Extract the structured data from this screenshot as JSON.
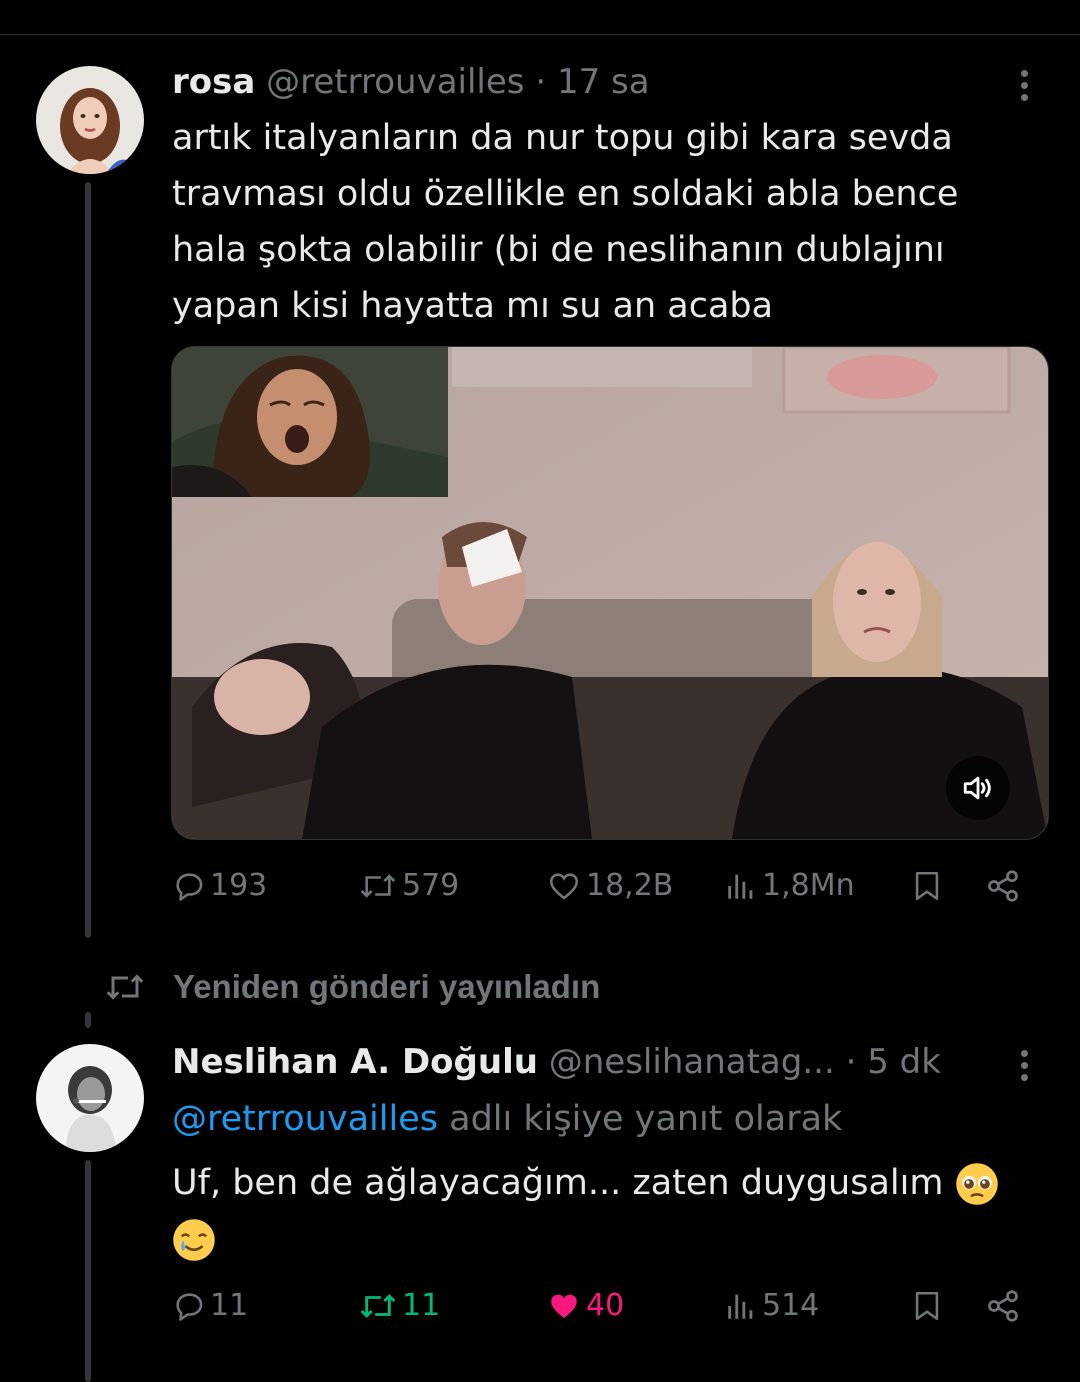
{
  "tweet1": {
    "display_name": "rosa",
    "handle": "@retrrouvailles",
    "separator": "·",
    "time": "17 sa",
    "text": "artık italyanların da nur topu gibi kara sevda travması oldu özellikle en soldaki abla bence hala şokta olabilir (bi de neslihanın dublajını yapan kisi hayatta mı su an acaba",
    "stats": {
      "replies": "193",
      "reposts": "579",
      "likes": "18,2B",
      "views": "1,8Mn"
    },
    "icons": [
      "more-icon",
      "reply-icon",
      "repost-icon",
      "like-icon",
      "views-icon",
      "bookmark-icon",
      "share-icon",
      "volume-icon"
    ]
  },
  "repost_note": {
    "text": "Yeniden gönderi yayınladın",
    "icon": "repost-icon"
  },
  "tweet2": {
    "display_name": "Neslihan A. Doğulu",
    "handle": "@neslihanatag...",
    "separator": "·",
    "time": "5 dk",
    "reply_to_handle": "@retrrouvailles",
    "reply_to_suffix": "adlı kişiye yanıt olarak",
    "text": "Uf, ben de ağlayacağım... zaten duygusalım",
    "emojis": [
      "pleading-face",
      "smiling-face-with-tear"
    ],
    "stats": {
      "replies": "11",
      "reposts": "11",
      "likes": "40",
      "views": "514"
    }
  },
  "colors": {
    "background": "#000000",
    "text": "#e7e9ea",
    "muted": "#71767b",
    "link": "#1d9bf0",
    "repost_active": "#00ba7c",
    "like_active": "#f91880"
  }
}
